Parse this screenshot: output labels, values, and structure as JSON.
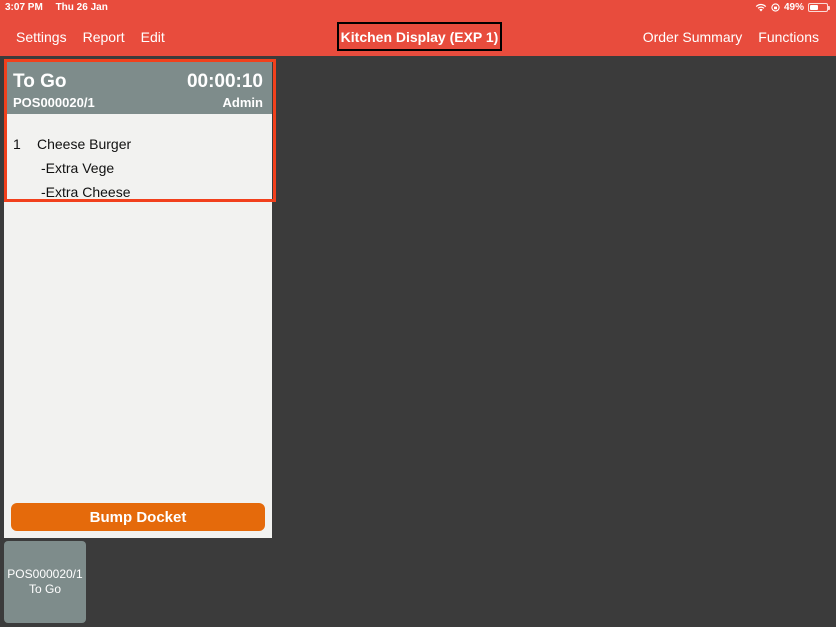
{
  "status_bar": {
    "time": "3:07 PM",
    "date": "Thu 26 Jan",
    "battery": "49%",
    "battery_fraction": 0.49,
    "icons": [
      "wifi-icon",
      "orientation-lock-icon",
      "battery-icon"
    ]
  },
  "header": {
    "title": "Kitchen Display (EXP 1)",
    "left_menu": [
      {
        "label": "Settings"
      },
      {
        "label": "Report"
      },
      {
        "label": "Edit"
      }
    ],
    "right_menu": [
      {
        "label": "Order Summary"
      },
      {
        "label": "Functions"
      }
    ]
  },
  "docket": {
    "order_type": "To Go",
    "timer": "00:00:10",
    "order_number": "POS000020/1",
    "user": "Admin",
    "items": [
      {
        "qty": "1",
        "name": "Cheese Burger",
        "modifiers": [
          "-Extra Vege",
          "-Extra Cheese"
        ]
      }
    ],
    "bump_label": "Bump Docket"
  },
  "thumbnails": [
    {
      "order_number": "POS000020/1",
      "order_type": "To Go"
    }
  ],
  "colors": {
    "header_bg": "#e84c3d",
    "docket_header_bg": "#7e8c8b",
    "bump_button": "#e56a0b",
    "highlight_border": "#f2401c",
    "background": "#3b3b3b"
  }
}
